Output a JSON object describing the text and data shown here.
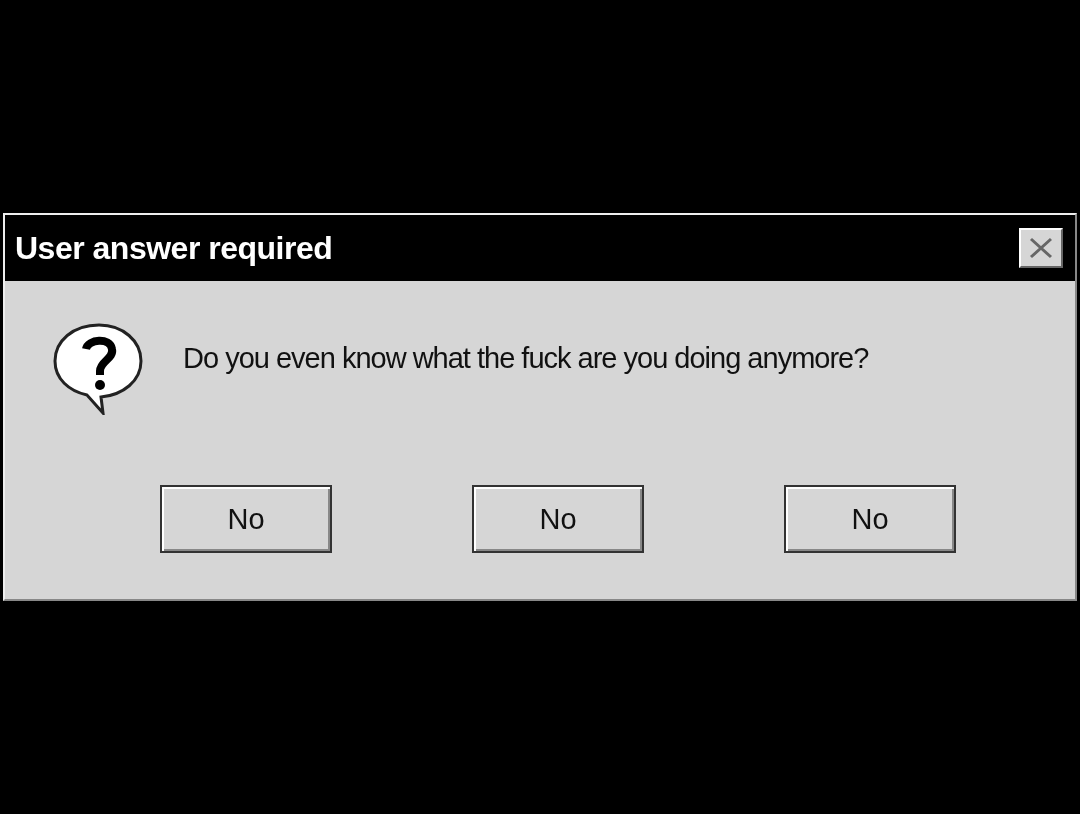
{
  "window": {
    "title": "User answer required"
  },
  "message": "Do you even know what the fuck are you doing anymore?",
  "buttons": [
    "No",
    "No",
    "No"
  ]
}
